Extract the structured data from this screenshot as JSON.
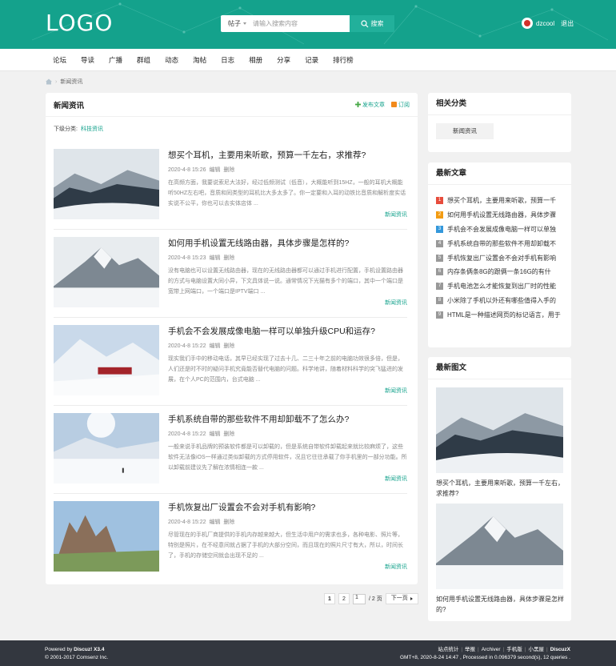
{
  "header": {
    "logo": "LOGO",
    "search_type": "帖子",
    "search_placeholder": "请输入搜索内容",
    "search_button": "搜索",
    "username": "dzcool",
    "logout": "退出"
  },
  "nav": [
    "论坛",
    "导读",
    "广播",
    "群组",
    "动态",
    "淘帖",
    "日志",
    "相册",
    "分享",
    "记录",
    "排行榜"
  ],
  "breadcrumb": {
    "current": "新闻资讯"
  },
  "main": {
    "title": "新闻资讯",
    "post_link": "发布文章",
    "rss_link": "订阅",
    "subcat_label": "下级分类:",
    "subcat_link": "科技资讯",
    "edit": "编辑",
    "delete": "删除",
    "articles": [
      {
        "title": "想买个耳机，主要用来听歌，预算一千左右，求推荐?",
        "date": "2020-4-8 15:26",
        "summary": "在高频方面，我要说索尼大法好，经过低频测试（低音），大概能听到15HZ，一般的耳机大概能听50HZ左右吧，音质和同类型的耳机比大多太多了。你一定要和入耳的动铁比音质和解析度实话实说不公平，你也可以去实体店体 ...",
        "category": "新闻资讯"
      },
      {
        "title": "如何用手机设置无线路由器，具体步骤是怎样的?",
        "date": "2020-4-8 15:23",
        "summary": "没有电脑也可以设置无线路由器，现在的无线路由器都可以通过手机进行配置，手机设置路由器的方式与电脑设置大同小异，下文具体说一说。通常情况下光猫有多个的端口，其中一个端口是宽带上网端口，一个端口是IPTV端口 ...",
        "category": "新闻资讯"
      },
      {
        "title": "手机会不会发展成像电脑一样可以单独升级CPU和运存?",
        "date": "2020-4-8 15:22",
        "summary": "现实我们手中的移动电话，其早已经实现了过去十几、二三十年之前的电脑功效很多倍，但是，人们还是时不时的疑问手机究竟能否替代电脑的问题。科学地讲，随着材料科学的突飞猛进的发展，在个人PC的范围内，台式电脑 ...",
        "category": "新闻资讯"
      },
      {
        "title": "手机系统自带的那些软件不用却卸载不了怎么办?",
        "date": "2020-4-8 15:22",
        "summary": "一般来说手机品牌的预装软件都是可以卸载的，但是系统自带软件卸载起来就比较麻烦了，这些软件无法像iOS一样通过类似卸载的方式停用软件，况且它往往承载了你手机里的一部分功能。所以卸载前建议先了解在浓情相连一款 ...",
        "category": "新闻资讯"
      },
      {
        "title": "手机恢复出厂设置会不会对手机有影响?",
        "date": "2020-4-8 15:22",
        "summary": "尽管现在的手机厂商提供的手机内存越来越大，但生活中用户的需求也多，各种电影、照片等，特别是照片，在不经意间就占据了手机的大部分空间，而且现在的照片尺寸有大，所以，时间长了，手机的存储空间就会出现不足的 ...",
        "category": "新闻资讯"
      }
    ]
  },
  "pager": {
    "p1": "1",
    "p2": "2",
    "input": "1",
    "total": "/ 2 页",
    "next": "下一页"
  },
  "sidebar": {
    "categories_title": "相关分类",
    "category_item": "新闻资讯",
    "latest_title": "最新文章",
    "latest": [
      {
        "num": "1",
        "color": "#e74c3c",
        "text": "想买个耳机，主要用来听歌，预算一千"
      },
      {
        "num": "2",
        "color": "#f39c12",
        "text": "如何用手机设置无线路由器，具体步骤"
      },
      {
        "num": "3",
        "color": "#3498db",
        "text": "手机会不会发展成像电脑一样可以单独"
      },
      {
        "num": "4",
        "color": "#999999",
        "text": "手机系统自带的那些软件不用却卸载不"
      },
      {
        "num": "5",
        "color": "#999999",
        "text": "手机恢复出厂设置会不会对手机有影响"
      },
      {
        "num": "6",
        "color": "#999999",
        "text": "内存条俩条8G的跟俩一条16G的有什"
      },
      {
        "num": "7",
        "color": "#999999",
        "text": "手机电池怎么才能恢复到出厂时的性能"
      },
      {
        "num": "8",
        "color": "#999999",
        "text": "小米除了手机以外还有哪些值得入手的"
      },
      {
        "num": "9",
        "color": "#999999",
        "text": "HTML是一种描述网页的标记语言，用于"
      }
    ],
    "images_title": "最新图文",
    "images": [
      {
        "caption": "想买个耳机，主要用来听歌，预算一千左右，求推荐?"
      },
      {
        "caption": "如何用手机设置无线路由器，具体步骤是怎样的?"
      }
    ]
  },
  "footer": {
    "powered_prefix": "Powered by",
    "powered_brand": "Discuz! X3.4",
    "copyright": "© 2001-2017 Comsenz Inc.",
    "links": [
      "站点统计",
      "举报",
      "Archiver",
      "手机版",
      "小黑屋",
      "DiscuzX"
    ],
    "stats": "GMT+8, 2020-8-24 14:47 , Processed in 0.096379 second(s), 12 queries ."
  },
  "colors": {
    "brand": "#14a28c",
    "footer": "#33373f"
  }
}
